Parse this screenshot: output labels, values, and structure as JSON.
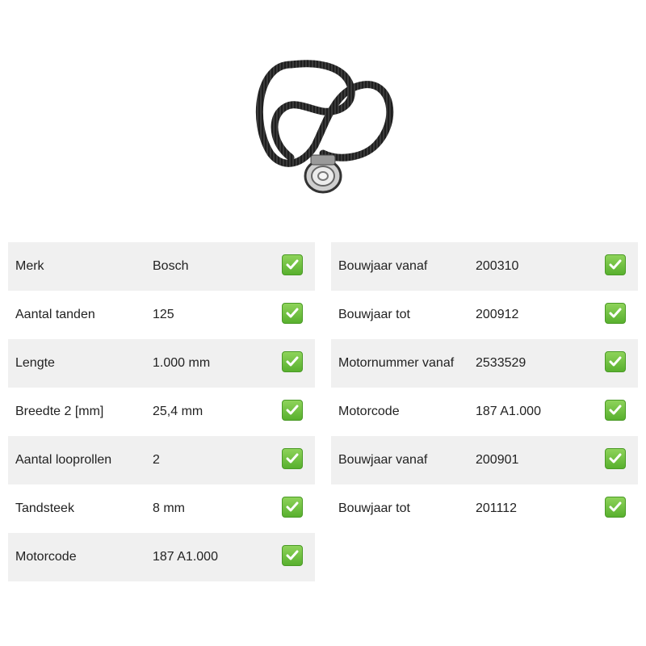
{
  "left_table": [
    {
      "label": "Merk",
      "value": "Bosch"
    },
    {
      "label": "Aantal tanden",
      "value": "125"
    },
    {
      "label": "Lengte",
      "value": "1.000 mm"
    },
    {
      "label": "Breedte 2 [mm]",
      "value": "25,4 mm"
    },
    {
      "label": "Aantal looprollen",
      "value": "2"
    },
    {
      "label": "Tandsteek",
      "value": "8 mm"
    },
    {
      "label": "Motorcode",
      "value": "187 A1.000"
    }
  ],
  "right_table": [
    {
      "label": "Bouwjaar vanaf",
      "value": "200310"
    },
    {
      "label": "Bouwjaar tot",
      "value": "200912"
    },
    {
      "label": "Motornummer vanaf",
      "value": "2533529"
    },
    {
      "label": "Motorcode",
      "value": "187 A1.000"
    },
    {
      "label": "Bouwjaar vanaf",
      "value": "200901"
    },
    {
      "label": "Bouwjaar tot",
      "value": "201112"
    }
  ],
  "colors": {
    "row_shade": "#f0f0f0",
    "check_green": "#58b02e"
  },
  "icons": {
    "status": "check-icon",
    "product": "timing-belt-kit-image"
  }
}
